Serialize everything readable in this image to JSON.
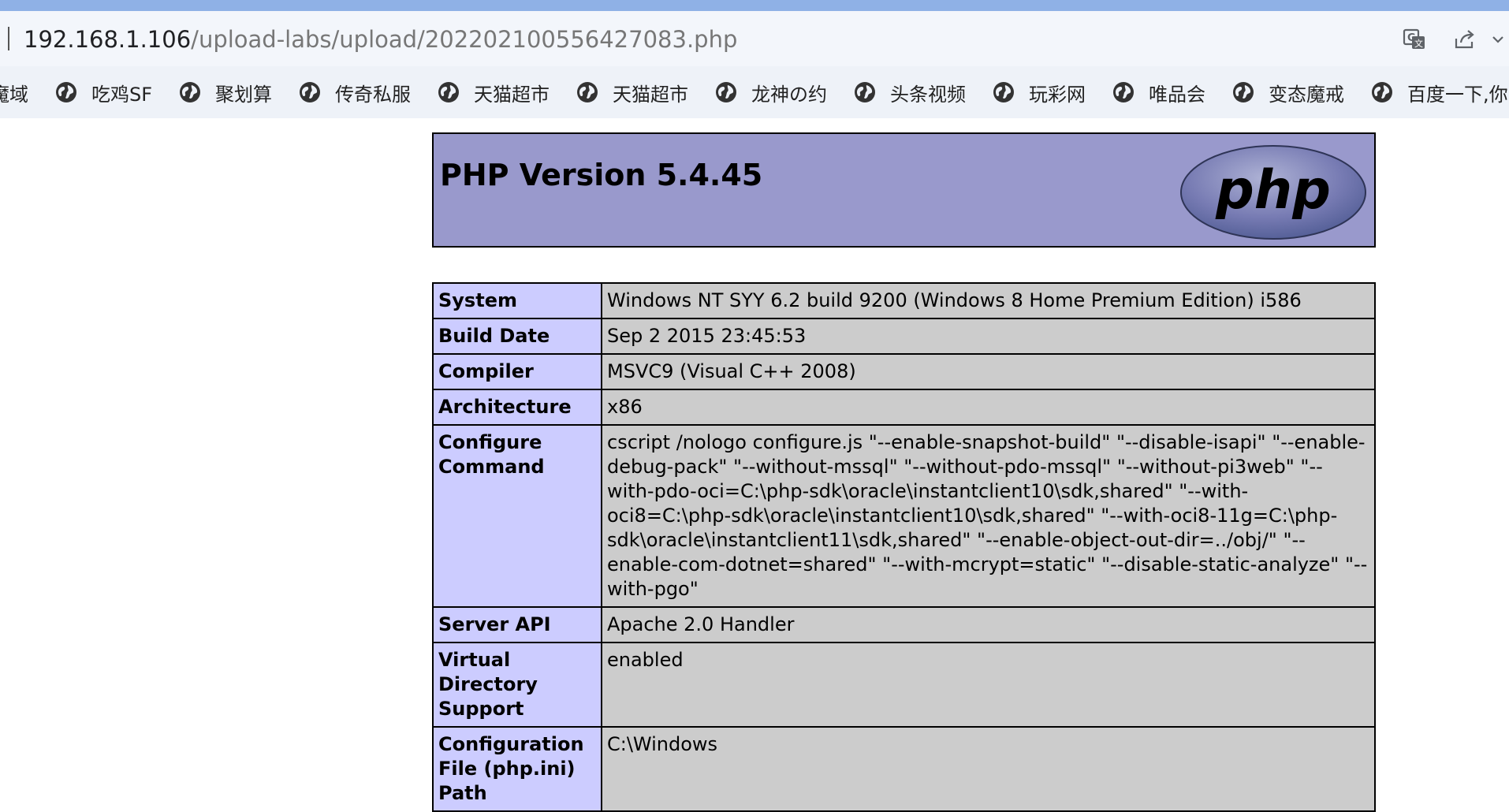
{
  "browser": {
    "url_host": "192.168.1.106",
    "url_path": "/upload-labs/upload/202202100556427083.php"
  },
  "bookmarks": [
    {
      "label": "魔域"
    },
    {
      "label": "吃鸡SF"
    },
    {
      "label": "聚划算"
    },
    {
      "label": "传奇私服"
    },
    {
      "label": "天猫超市"
    },
    {
      "label": "天猫超市"
    },
    {
      "label": "龙神の约"
    },
    {
      "label": "头条视频"
    },
    {
      "label": "玩彩网"
    },
    {
      "label": "唯品会"
    },
    {
      "label": "变态魔戒"
    },
    {
      "label": "百度一下,你"
    }
  ],
  "phpinfo": {
    "title": "PHP Version 5.4.45",
    "logo_text": "php",
    "colors": {
      "header_bg": "#9999cc",
      "label_bg": "#ccccff",
      "value_bg": "#cccccc"
    },
    "rows": [
      {
        "label": "System",
        "value": "Windows NT SYY 6.2 build 9200 (Windows 8 Home Premium Edition) i586"
      },
      {
        "label": "Build Date",
        "value": "Sep 2 2015 23:45:53"
      },
      {
        "label": "Compiler",
        "value": "MSVC9 (Visual C++ 2008)"
      },
      {
        "label": "Architecture",
        "value": "x86"
      },
      {
        "label": "Configure Command",
        "value": "cscript /nologo configure.js \"--enable-snapshot-build\" \"--disable-isapi\" \"--enable-debug-pack\" \"--without-mssql\" \"--without-pdo-mssql\" \"--without-pi3web\" \"--with-pdo-oci=C:\\php-sdk\\oracle\\instantclient10\\sdk,shared\" \"--with-oci8=C:\\php-sdk\\oracle\\instantclient10\\sdk,shared\" \"--with-oci8-11g=C:\\php-sdk\\oracle\\instantclient11\\sdk,shared\" \"--enable-object-out-dir=../obj/\" \"--enable-com-dotnet=shared\" \"--with-mcrypt=static\" \"--disable-static-analyze\" \"--with-pgo\""
      },
      {
        "label": "Server API",
        "value": "Apache 2.0 Handler"
      },
      {
        "label": "Virtual Directory Support",
        "value": "enabled"
      },
      {
        "label": "Configuration File (php.ini) Path",
        "value": "C:\\Windows"
      }
    ]
  }
}
